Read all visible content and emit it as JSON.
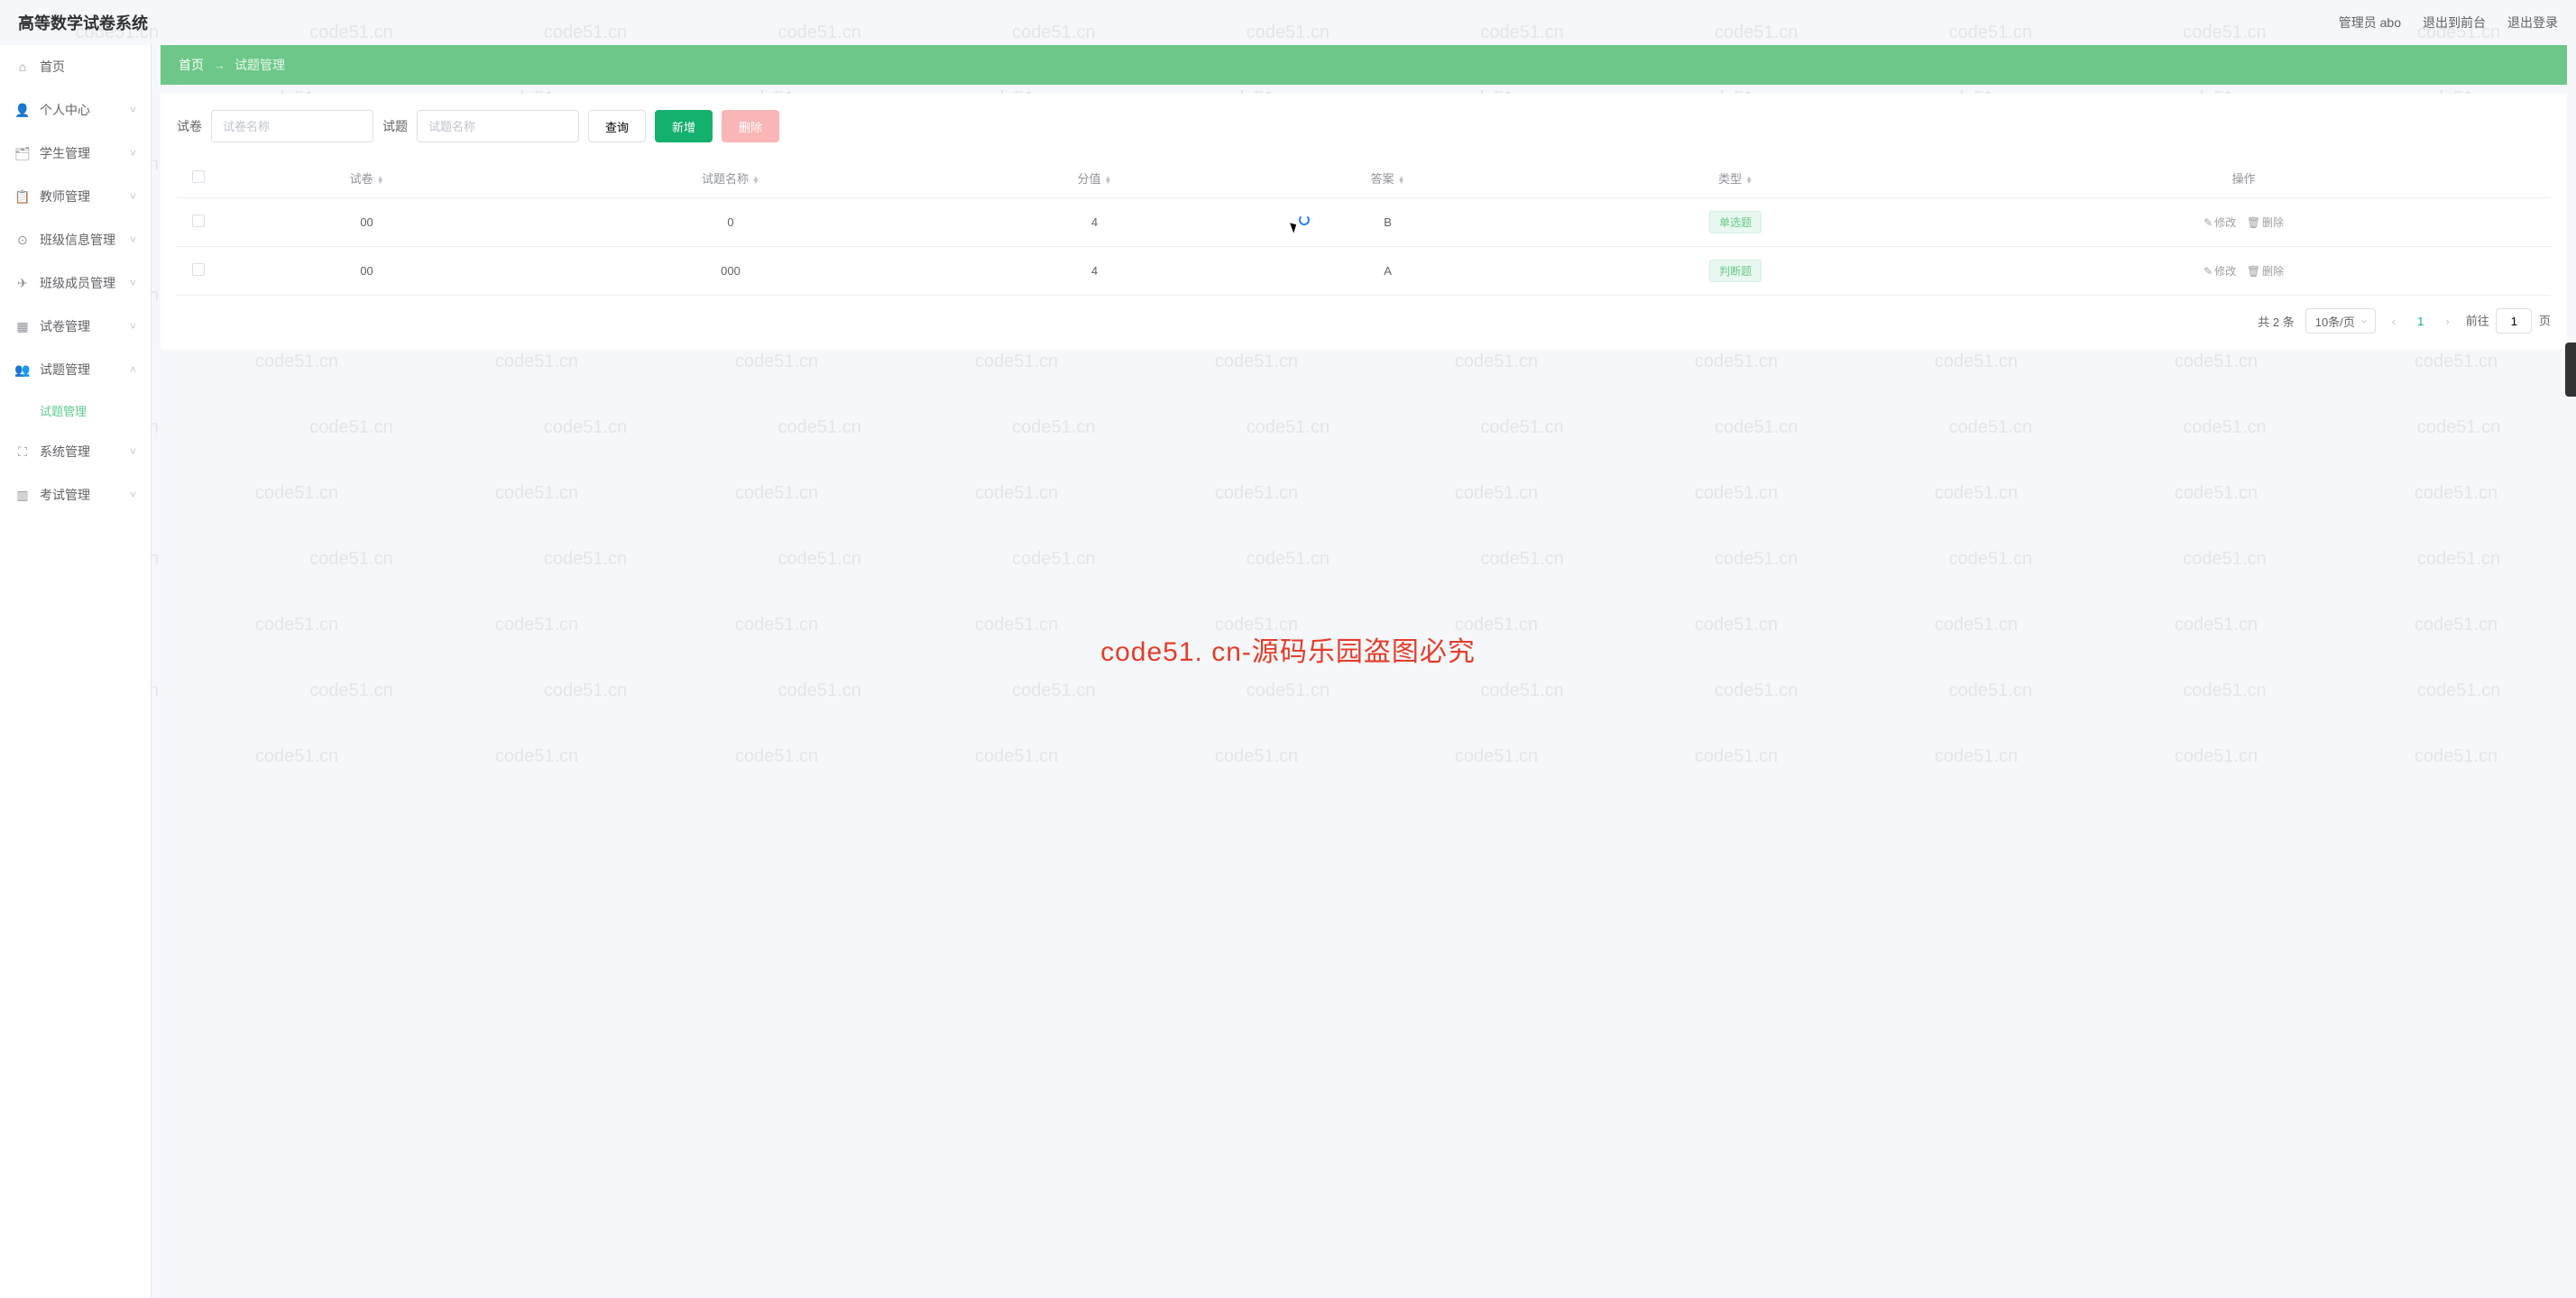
{
  "watermark": "code51.cn",
  "header": {
    "logo": "高等数学试卷系统",
    "admin_label": "管理员 abo",
    "back_frontend": "退出到前台",
    "logout": "退出登录"
  },
  "sidebar": {
    "items": [
      {
        "icon": "home",
        "label": "首页",
        "expandable": false
      },
      {
        "icon": "user",
        "label": "个人中心",
        "expandable": true
      },
      {
        "icon": "student",
        "label": "学生管理",
        "expandable": true
      },
      {
        "icon": "teacher",
        "label": "教师管理",
        "expandable": true
      },
      {
        "icon": "class",
        "label": "班级信息管理",
        "expandable": true
      },
      {
        "icon": "member",
        "label": "班级成员管理",
        "expandable": true
      },
      {
        "icon": "paper",
        "label": "试卷管理",
        "expandable": true
      },
      {
        "icon": "question",
        "label": "试题管理",
        "expandable": true,
        "expanded": true,
        "children": [
          {
            "label": "试题管理",
            "active": true
          }
        ]
      },
      {
        "icon": "system",
        "label": "系统管理",
        "expandable": true
      },
      {
        "icon": "exam",
        "label": "考试管理",
        "expandable": true
      }
    ]
  },
  "breadcrumb": {
    "home": "首页",
    "current": "试题管理"
  },
  "search": {
    "label_paper": "试卷",
    "placeholder_paper": "试卷名称",
    "label_question": "试题",
    "placeholder_question": "试题名称",
    "btn_query": "查询",
    "btn_add": "新增",
    "btn_delete": "删除"
  },
  "table": {
    "headers": {
      "paper": "试卷",
      "question_name": "试题名称",
      "score": "分值",
      "answer": "答案",
      "type": "类型",
      "action": "操作"
    },
    "action_edit": "修改",
    "action_delete": "删除",
    "rows": [
      {
        "paper": "00",
        "question_name": "0",
        "score": "4",
        "answer": "B",
        "type": "单选题"
      },
      {
        "paper": "00",
        "question_name": "000",
        "score": "4",
        "answer": "A",
        "type": "判断题"
      }
    ]
  },
  "pagination": {
    "total_label": "共 2 条",
    "per_page": "10条/页",
    "current": "1",
    "goto_prefix": "前往",
    "goto_value": "1",
    "goto_suffix": "页"
  },
  "overlay_text": "code51. cn-源码乐园盗图必究"
}
